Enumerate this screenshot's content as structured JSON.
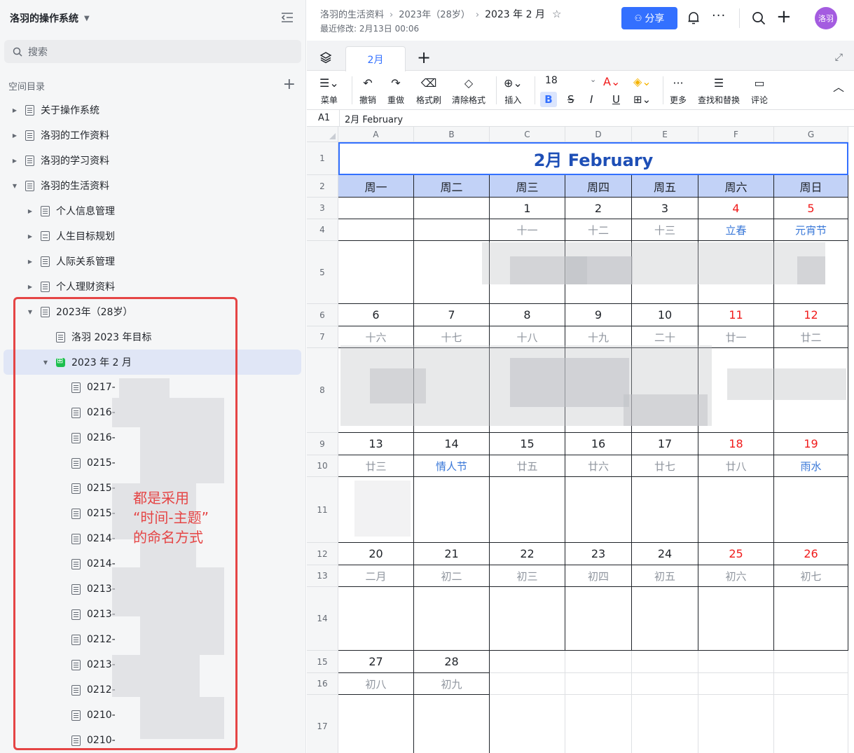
{
  "sidebar": {
    "title": "洛羽的操作系统",
    "search_placeholder": "搜索",
    "section_label": "空间目录",
    "items": [
      {
        "label": "关于操作系统"
      },
      {
        "label": "洛羽的工作资料"
      },
      {
        "label": "洛羽的学习资料"
      },
      {
        "label": "洛羽的生活资料"
      },
      {
        "label": "个人信息管理"
      },
      {
        "label": "人生目标规划"
      },
      {
        "label": "人际关系管理"
      },
      {
        "label": "个人理财资料"
      },
      {
        "label": "2023年（28岁）"
      },
      {
        "label": "洛羽 2023 年目标"
      },
      {
        "label": "2023 年 2 月"
      },
      {
        "label": "0217-"
      },
      {
        "label": "0216-"
      },
      {
        "label": "0216-"
      },
      {
        "label": "0215-"
      },
      {
        "label": "0215-"
      },
      {
        "label": "0215-"
      },
      {
        "label": "0214-"
      },
      {
        "label": "0214-"
      },
      {
        "label": "0213-"
      },
      {
        "label": "0213-"
      },
      {
        "label": "0212-"
      },
      {
        "label": "0213-"
      },
      {
        "label": "0212-"
      },
      {
        "label": "0210-"
      },
      {
        "label": "0210-"
      }
    ],
    "annotation": "都是采用\n“时间-主题”\n的命名方式"
  },
  "header": {
    "breadcrumb": [
      "洛羽的生活资料",
      "2023年（28岁）",
      "2023 年 2 月"
    ],
    "modified": "最近修改: 2月13日 00:06",
    "share_label": "分享",
    "avatar_text": "洛羽"
  },
  "tabs": {
    "active": "2月"
  },
  "toolbar": {
    "menu": "菜单",
    "undo": "撤销",
    "redo": "重做",
    "format_painter": "格式刷",
    "clear_format": "清除格式",
    "insert": "插入",
    "font_size": "18",
    "more": "更多",
    "find_replace": "查找和替换",
    "comment": "评论"
  },
  "formula_bar": {
    "ref": "A1",
    "value": "2月 February"
  },
  "sheet": {
    "columns": [
      "A",
      "B",
      "C",
      "D",
      "E",
      "F",
      "G"
    ],
    "rows": [
      "1",
      "2",
      "3",
      "4",
      "5",
      "6",
      "7",
      "8",
      "9",
      "10",
      "11",
      "12",
      "13",
      "14",
      "15",
      "16",
      "17"
    ],
    "title": "2月 February",
    "weekdays": [
      "周一",
      "周二",
      "周三",
      "周四",
      "周五",
      "周六",
      "周日"
    ],
    "weeks": [
      {
        "dates": [
          "",
          "",
          "1",
          "2",
          "3",
          "4",
          "5"
        ],
        "lunar": [
          "",
          "",
          "十一",
          "十二",
          "十三",
          "立春",
          "元宵节"
        ]
      },
      {
        "dates": [
          "6",
          "7",
          "8",
          "9",
          "10",
          "11",
          "12"
        ],
        "lunar": [
          "十六",
          "十七",
          "十八",
          "十九",
          "二十",
          "廿一",
          "廿二"
        ]
      },
      {
        "dates": [
          "13",
          "14",
          "15",
          "16",
          "17",
          "18",
          "19"
        ],
        "lunar": [
          "廿三",
          "情人节",
          "廿五",
          "廿六",
          "廿七",
          "廿八",
          "雨水"
        ]
      },
      {
        "dates": [
          "20",
          "21",
          "22",
          "23",
          "24",
          "25",
          "26"
        ],
        "lunar": [
          "二月",
          "初二",
          "初三",
          "初四",
          "初五",
          "初六",
          "初七"
        ]
      },
      {
        "dates": [
          "27",
          "28",
          "",
          "",
          "",
          "",
          ""
        ],
        "lunar": [
          "初八",
          "初九",
          "",
          "",
          "",
          "",
          ""
        ]
      }
    ]
  }
}
